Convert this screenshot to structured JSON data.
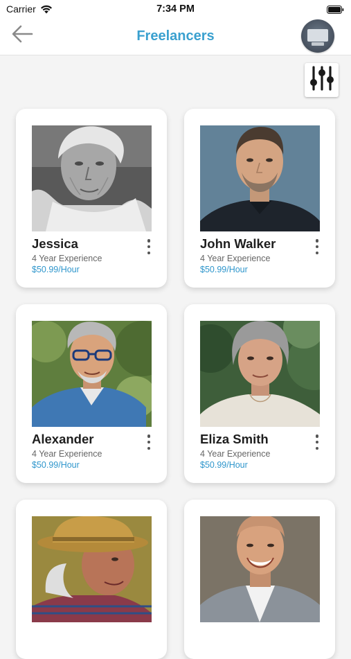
{
  "status_bar": {
    "carrier": "Carrier",
    "time": "7:34 PM"
  },
  "nav": {
    "title": "Freelancers",
    "back_icon": "arrow-left-icon",
    "filter_icon": "sliders-icon",
    "title_color": "#3aa0cf"
  },
  "freelancers": [
    {
      "name": "Jessica",
      "experience": "4 Year Experience",
      "rate": "$50.99/Hour",
      "photo": "elderly-woman-bw-portrait"
    },
    {
      "name": "John Walker",
      "experience": "4 Year Experience",
      "rate": "$50.99/Hour",
      "photo": "middle-aged-man-portrait"
    },
    {
      "name": "Alexander",
      "experience": "4 Year Experience",
      "rate": "$50.99/Hour",
      "photo": "older-man-glasses-portrait"
    },
    {
      "name": "Eliza Smith",
      "experience": "4 Year Experience",
      "rate": "$50.99/Hour",
      "photo": "older-woman-portrait"
    },
    {
      "photo": "older-man-straw-hat-portrait"
    },
    {
      "photo": "smiling-bald-man-portrait"
    }
  ],
  "colors": {
    "accent": "#3aa0cf",
    "rate": "#2f96cc",
    "background": "#f4f4f4"
  }
}
